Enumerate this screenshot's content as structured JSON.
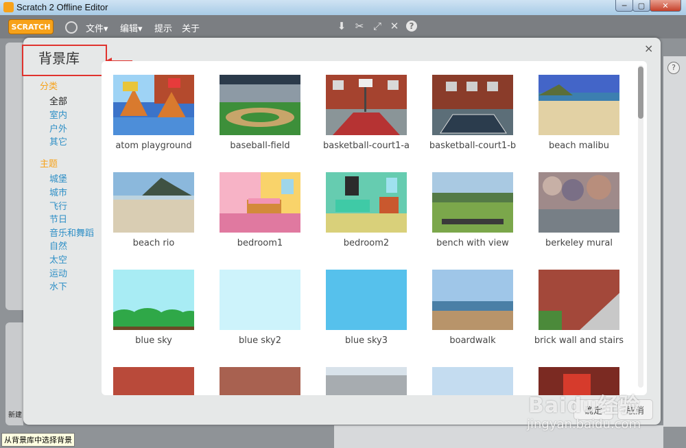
{
  "window": {
    "title": "Scratch 2 Offline Editor",
    "min": "─",
    "max": "▢",
    "close": "✕"
  },
  "menubar": {
    "logo": "SCRATCH",
    "items": [
      "文件▾",
      "编辑▾",
      "提示",
      "关于"
    ]
  },
  "dialog": {
    "title": "背景库",
    "close": "×",
    "sidebar": {
      "category_heading": "分类",
      "categories": [
        "全部",
        "室内",
        "户外",
        "其它"
      ],
      "theme_heading": "主题",
      "themes": [
        "城堡",
        "城市",
        "飞行",
        "节日",
        "音乐和舞蹈",
        "自然",
        "太空",
        "运动",
        "水下"
      ]
    },
    "items": [
      "atom playground",
      "baseball-field",
      "basketball-court1-a",
      "basketball-court1-b",
      "beach malibu",
      "beach rio",
      "bedroom1",
      "bedroom2",
      "bench with view",
      "berkeley mural",
      "blue sky",
      "blue sky2",
      "blue sky3",
      "boardwalk",
      "brick wall and stairs"
    ],
    "ok": "确定",
    "cancel": "取消"
  },
  "editor": {
    "new_label": "新建",
    "tooltip": "从背景库中选择背景"
  },
  "watermark": {
    "main": "Baidu经验",
    "sub": "jingyan.baidu.com"
  }
}
